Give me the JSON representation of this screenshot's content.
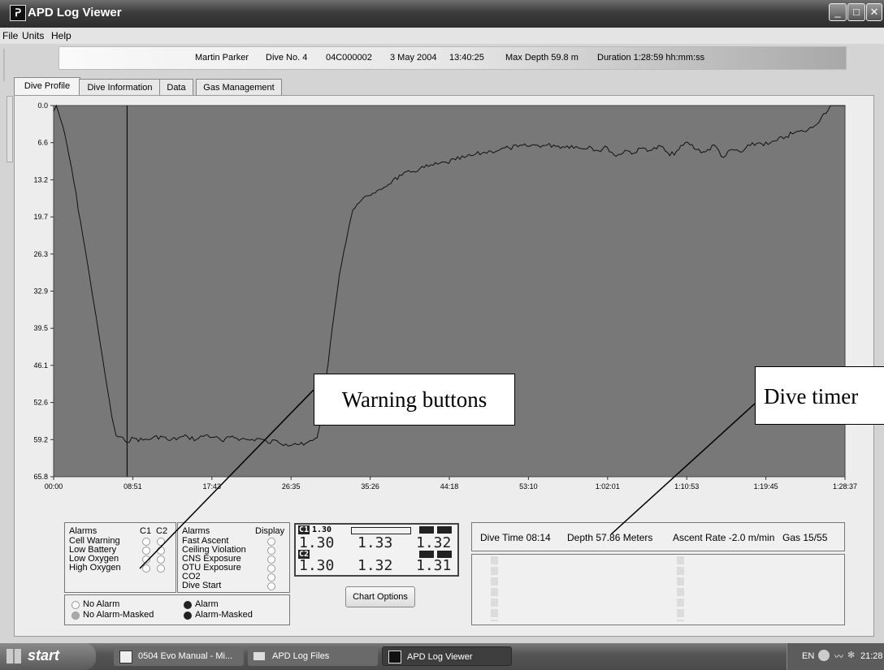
{
  "window": {
    "title": "APD Log Viewer",
    "minimize": "_",
    "maximize": "□",
    "close": "✕"
  },
  "menu": [
    "File",
    "Units",
    "Help"
  ],
  "info": {
    "diver": "Martin Parker",
    "dive_no": "Dive No. 4",
    "serial": "04C000002",
    "date": "3 May 2004",
    "time": "13:40:25",
    "max_depth": "Max Depth 59.8 m",
    "duration": "Duration 1:28:59 hh:mm:ss"
  },
  "tabs": [
    "Dive Profile",
    "Dive Information",
    "Data",
    "Gas Management"
  ],
  "chart_data": {
    "type": "line",
    "y_ticks": [
      "0.0",
      "6.6",
      "13.2",
      "19.7",
      "26.3",
      "32.9",
      "39.5",
      "46.1",
      "52.6",
      "59.2",
      "65.8"
    ],
    "x_ticks": [
      "00:00",
      "08:51",
      "17:43",
      "26:35",
      "35:26",
      "44:18",
      "53:10",
      "1:02:01",
      "1:10:53",
      "1:19:45",
      "1:28:37"
    ],
    "ylim": [
      65.8,
      0
    ],
    "xlim_min": [
      0,
      88.62
    ],
    "cursor_min": 8.23,
    "background": "#787878",
    "line_color": "#111111",
    "x_min": [
      0,
      0.3,
      1,
      2,
      3,
      4,
      5,
      6,
      6.5,
      7,
      8,
      9,
      10,
      11,
      12,
      13,
      14,
      15,
      16,
      17,
      18,
      19,
      20,
      21,
      22,
      23,
      24,
      25,
      26,
      27,
      28,
      29,
      29.5,
      30,
      31,
      32,
      33,
      33.5,
      34,
      35,
      36,
      37,
      38,
      39,
      40,
      41,
      42,
      43,
      44,
      45,
      46,
      47,
      48,
      49,
      50,
      51,
      52,
      53,
      54,
      55,
      56,
      57,
      58,
      59,
      60,
      61,
      62,
      63,
      64,
      65,
      66,
      67,
      68,
      69,
      70,
      71,
      72,
      73,
      74,
      75,
      76,
      77,
      78,
      79,
      80,
      81,
      82,
      83,
      84,
      85,
      86,
      87,
      88,
      88.62
    ],
    "depth_m": [
      1.0,
      0.0,
      3.5,
      11.0,
      20.5,
      30.0,
      40.0,
      50.0,
      55.0,
      58.5,
      59.5,
      59.0,
      59.3,
      59.0,
      58.6,
      59.4,
      58.9,
      58.7,
      59.2,
      58.4,
      58.8,
      59.6,
      58.6,
      59.1,
      59.3,
      59.0,
      59.8,
      59.4,
      60.0,
      59.9,
      60.2,
      59.4,
      58.9,
      55.0,
      42.0,
      30.0,
      22.0,
      18.5,
      17.5,
      16.0,
      15.5,
      14.5,
      13.2,
      12.4,
      11.8,
      11.2,
      10.8,
      10.4,
      10.1,
      9.6,
      9.2,
      8.8,
      8.4,
      8.1,
      7.8,
      7.5,
      7.3,
      7.2,
      7.0,
      7.1,
      7.0,
      7.3,
      7.1,
      7.6,
      7.2,
      8.0,
      7.4,
      9.0,
      7.9,
      8.4,
      7.5,
      7.9,
      7.2,
      8.9,
      7.8,
      6.5,
      7.8,
      8.2,
      7.0,
      9.2,
      7.8,
      8.3,
      7.1,
      6.6,
      6.9,
      6.2,
      5.5,
      4.8,
      4.6,
      3.9,
      2.0,
      0.0,
      0.0,
      0.0
    ]
  },
  "alarms1": {
    "h1": "Alarms",
    "h2": "C1",
    "h3": "C2",
    "rows": [
      "Cell Warning",
      "Low Battery",
      "Low Oxygen",
      "High Oxygen"
    ]
  },
  "alarms2": {
    "h1": "Alarms",
    "h2": "Display",
    "rows": [
      "Fast Ascent",
      "Ceiling Violation",
      "CNS Exposure",
      "OTU Exposure",
      "CO2",
      "Dive Start"
    ]
  },
  "legend": [
    "No Alarm",
    "No Alarm-Masked",
    "Alarm",
    "Alarm-Masked"
  ],
  "lcd": {
    "c1_tag": "C1",
    "c1_set": "1.30",
    "c2_tag": "C2",
    "r1": [
      "1.30",
      "1.33",
      "1.32"
    ],
    "r2": [
      "1.30",
      "1.32",
      "1.31"
    ]
  },
  "chart_options": "Chart Options",
  "status": {
    "dive_time": "Dive Time 08:14",
    "depth": "Depth 57.86 Meters",
    "ascent": "Ascent Rate -2.0 m/min",
    "gas": "Gas 15/55"
  },
  "callouts": {
    "warning": "Warning buttons",
    "timer": "Dive timer"
  },
  "taskbar": {
    "start": "start",
    "items": [
      "0504 Evo Manual - Mi...",
      "APD Log Files",
      "APD Log Viewer"
    ],
    "lang": "EN",
    "clock": "21:28"
  }
}
